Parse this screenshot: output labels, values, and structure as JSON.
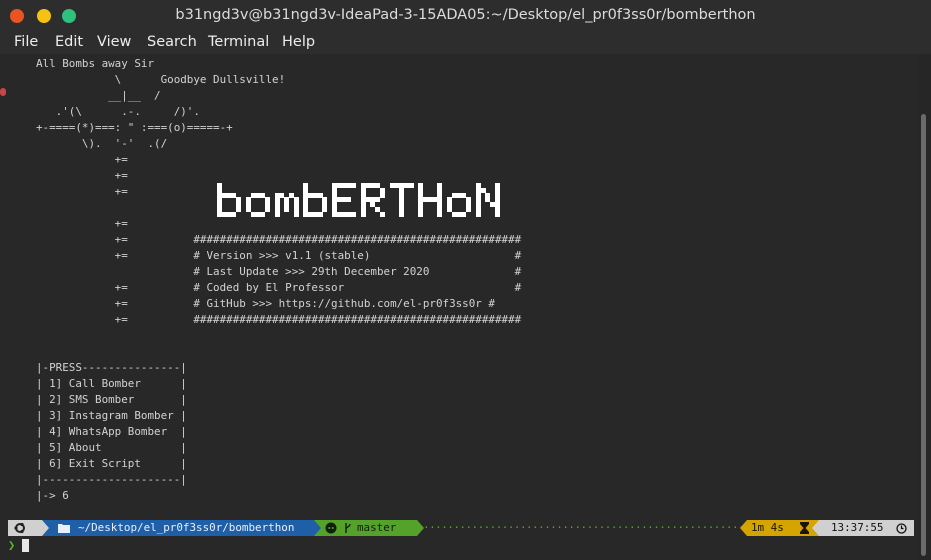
{
  "window": {
    "title": "b31ngd3v@b31ngd3v-IdeaPad-3-15ADA05:~/Desktop/el_pr0f3ss0r/bomberthon"
  },
  "menu": [
    "File",
    "Edit",
    "View",
    "Search",
    "Terminal",
    "Help"
  ],
  "terminal": {
    "lines": [
      "All Bombs away Sir",
      "            \\      Goodbye Dullsville!",
      "           __|__  /",
      "   .'(\\      .-.     /)'.",
      "+-====(*)===: \" :===(o)=====-+",
      "       \\).  '-'  .(/",
      "            +=",
      "            +=",
      "            +=",
      "",
      "            +=",
      "            +=          ##################################################",
      "            +=          # Version >>> v1.1 (stable)                      #",
      "                        # Last Update >>> 29th December 2020             #",
      "            +=          # Coded by El Professor                          #",
      "            +=          # GitHub >>> https://github.com/el-pr0f3ss0r #",
      "            +=          ##################################################",
      "",
      "",
      "|-PRESS---------------|",
      "| 1] Call Bomber      |",
      "| 2] SMS Bomber       |",
      "| 3] Instagram Bomber |",
      "| 4] WhatsApp Bomber  |",
      "| 5] About            |",
      "| 6] Exit Script      |",
      "|---------------------|",
      "|-> 6"
    ],
    "banner_text": "BOMBERTHON"
  },
  "prompt": {
    "os_icon": "ubuntu-icon",
    "path": "~/Desktop/el_pr0f3ss0r/bomberthon",
    "path_icon": "folder-icon",
    "git_icon": "github-icon",
    "branch_icon": "git-branch-icon",
    "branch": "master",
    "duration": "1m 4s",
    "duration_icon": "hourglass-icon",
    "time": "13:37:55",
    "time_icon": "clock-icon",
    "prompt_symbol": "❯"
  },
  "colors": {
    "path_bg": "#1f5fa8",
    "git_bg": "#55a22a",
    "duration_bg": "#d4a400",
    "accent_prompt": "#4ebf2a"
  }
}
